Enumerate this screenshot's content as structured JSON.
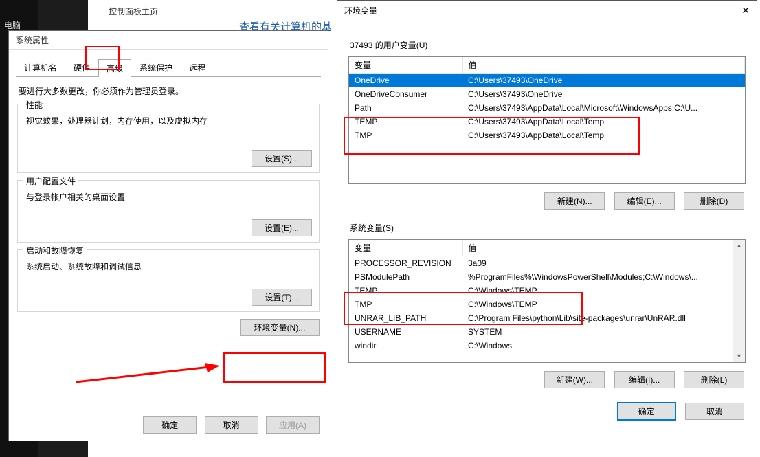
{
  "background": {
    "panel_home": "控制面板主页",
    "heading": "查看有关计算机的基",
    "left_label": "电脑"
  },
  "sysprops": {
    "title": "系统属性",
    "tabs": {
      "computer_name": "计算机名",
      "hardware": "硬件",
      "advanced": "高级",
      "system_protection": "系统保护",
      "remote": "远程"
    },
    "note": "要进行大多数更改，你必须作为管理员登录。",
    "perf": {
      "legend": "性能",
      "desc": "视觉效果，处理器计划，内存使用，以及虚拟内存",
      "button": "设置(S)..."
    },
    "profiles": {
      "legend": "用户配置文件",
      "desc": "与登录帐户相关的桌面设置",
      "button": "设置(E)..."
    },
    "startup": {
      "legend": "启动和故障恢复",
      "desc": "系统启动、系统故障和调试信息",
      "button": "设置(T)..."
    },
    "env_button": "环境变量(N)...",
    "ok": "确定",
    "cancel": "取消",
    "apply": "应用(A)"
  },
  "envdlg": {
    "title": "环境变量",
    "user_section": "37493 的用户变量(U)",
    "sys_section": "系统变量(S)",
    "col_var": "变量",
    "col_val": "值",
    "user_vars": [
      {
        "name": "OneDrive",
        "value": "C:\\Users\\37493\\OneDrive",
        "sel": true
      },
      {
        "name": "OneDriveConsumer",
        "value": "C:\\Users\\37493\\OneDrive"
      },
      {
        "name": "Path",
        "value": "C:\\Users\\37493\\AppData\\Local\\Microsoft\\WindowsApps;C:\\U..."
      },
      {
        "name": "TEMP",
        "value": "C:\\Users\\37493\\AppData\\Local\\Temp"
      },
      {
        "name": "TMP",
        "value": "C:\\Users\\37493\\AppData\\Local\\Temp"
      }
    ],
    "sys_vars": [
      {
        "name": "PROCESSOR_REVISION",
        "value": "3a09"
      },
      {
        "name": "PSModulePath",
        "value": "%ProgramFiles%\\WindowsPowerShell\\Modules;C:\\Windows\\..."
      },
      {
        "name": "TEMP",
        "value": "C:\\Windows\\TEMP"
      },
      {
        "name": "TMP",
        "value": "C:\\Windows\\TEMP"
      },
      {
        "name": "UNRAR_LIB_PATH",
        "value": "C:\\Program Files\\python\\Lib\\site-packages\\unrar\\UnRAR.dll"
      },
      {
        "name": "USERNAME",
        "value": "SYSTEM"
      },
      {
        "name": "windir",
        "value": "C:\\Windows"
      }
    ],
    "new_u": "新建(N)...",
    "edit_u": "编辑(E)...",
    "del_u": "删除(D)",
    "new_s": "新建(W)...",
    "edit_s": "编辑(I)...",
    "del_s": "删除(L)",
    "ok": "确定",
    "cancel": "取消"
  }
}
